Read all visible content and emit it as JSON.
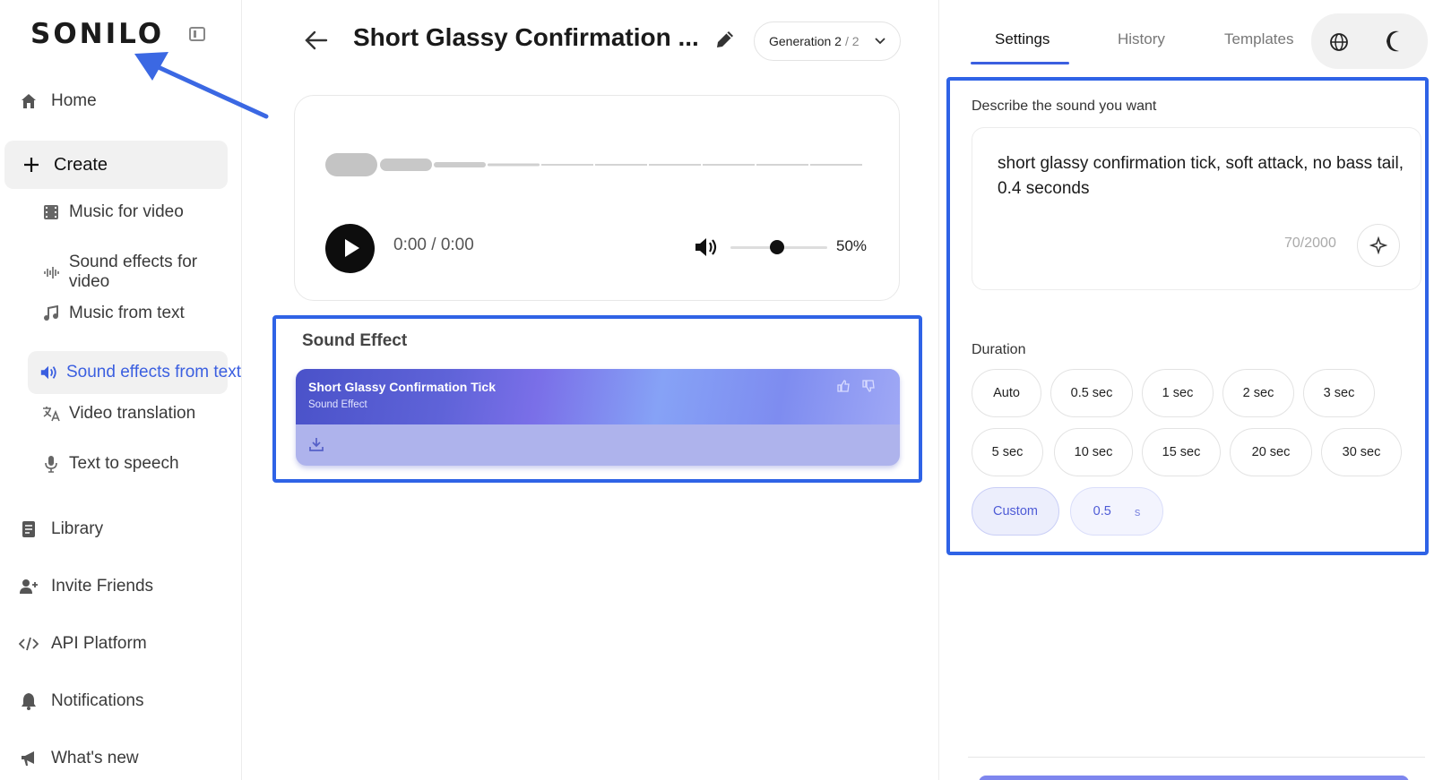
{
  "sidebar": {
    "logo": "SONILO",
    "items": [
      {
        "label": "Home",
        "icon": "home-icon"
      },
      {
        "label": "Create",
        "icon": "plus-icon"
      },
      {
        "label": "Library",
        "icon": "library-icon"
      },
      {
        "label": "Invite Friends",
        "icon": "add-user-icon"
      },
      {
        "label": "API Platform",
        "icon": "code-icon"
      },
      {
        "label": "Notifications",
        "icon": "bell-icon"
      },
      {
        "label": "What's new",
        "icon": "megaphone-icon"
      }
    ],
    "create_sub": [
      {
        "label": "Music for video",
        "icon": "film-icon"
      },
      {
        "label": "Sound effects for video",
        "icon": "waveform-icon"
      },
      {
        "label": "Music from text",
        "icon": "music-note-icon"
      },
      {
        "label": "Sound effects from text",
        "icon": "speaker-icon",
        "active": true
      },
      {
        "label": "Video translation",
        "icon": "translate-icon"
      },
      {
        "label": "Text to speech",
        "icon": "microphone-icon"
      }
    ]
  },
  "header": {
    "title": "Short Glassy Confirmation ...",
    "generation_label": "Generation 2",
    "generation_count": "/ 2"
  },
  "player": {
    "time": "0:00 / 0:00",
    "volume": "50%",
    "volume_level": 0.5
  },
  "sound_effect": {
    "section_title": "Sound Effect",
    "name": "Short Glassy Confirmation Tick",
    "type": "Sound Effect"
  },
  "tabs": [
    "Settings",
    "History",
    "Templates"
  ],
  "settings": {
    "describe_label": "Describe the sound you want",
    "prompt": "short glassy confirmation tick, soft attack, no bass tail, 0.4 seconds",
    "char_count": "70/2000",
    "duration_label": "Duration",
    "durations": [
      "Auto",
      "0.5 sec",
      "1 sec",
      "2 sec",
      "3 sec",
      "5 sec",
      "10 sec",
      "15 sec",
      "20 sec",
      "30 sec"
    ],
    "custom_label": "Custom",
    "custom_value": "0.5",
    "custom_unit": "s"
  },
  "colors": {
    "accent": "#3b5fe0",
    "highlight_border": "#2f63e6",
    "card_gradient_start": "#4a52c9",
    "card_gradient_end": "#9fa8f5"
  }
}
